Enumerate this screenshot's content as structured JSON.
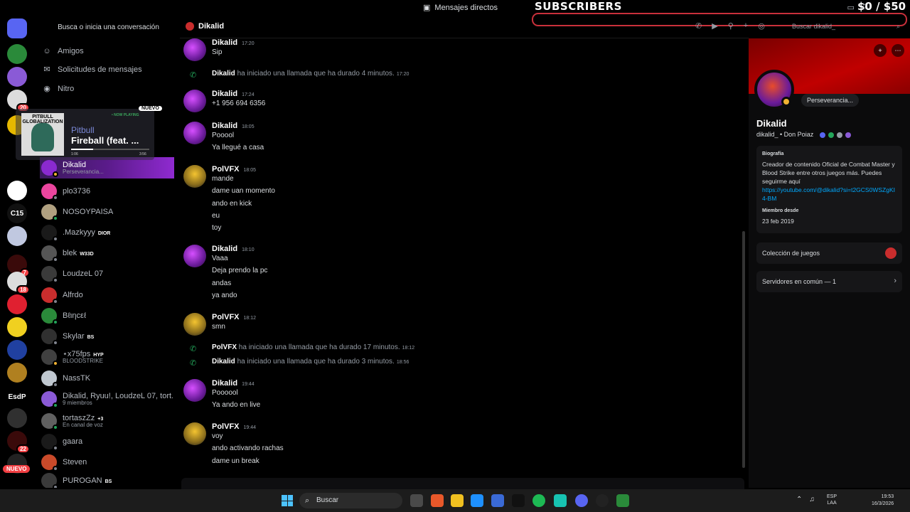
{
  "titlebar": {
    "title": "Mensajes directos"
  },
  "overlay": {
    "subscribers": "SUBSCRIBERS",
    "money": "$0 / $50"
  },
  "rail": {
    "servers": [
      {
        "name": "discord-home",
        "color": "#5865f2",
        "label": ""
      },
      {
        "name": "server-green",
        "color": "#2a8a3a",
        "label": "",
        "badge": ""
      },
      {
        "name": "server-purple",
        "color": "#8a5ad6",
        "label": ""
      },
      {
        "name": "server-voice",
        "color": "#dcdcdc",
        "label": "",
        "badge": "20"
      },
      {
        "name": "server-fortnite",
        "color": "#e6b800",
        "label": ""
      },
      {
        "name": "server-ghost",
        "color": "#ffffff",
        "label": ""
      },
      {
        "name": "server-c15",
        "color": "#111111",
        "label": "C15"
      },
      {
        "name": "server-anime",
        "color": "#c0c8e0",
        "label": ""
      },
      {
        "name": "server-red",
        "color": "#3a0a0a",
        "label": "",
        "badge": "7"
      },
      {
        "name": "server-skull",
        "color": "#dddddd",
        "label": "",
        "badge": "18"
      },
      {
        "name": "server-tiktok",
        "color": "#e02030",
        "label": ""
      },
      {
        "name": "server-yellow",
        "color": "#f0d020",
        "label": ""
      },
      {
        "name": "server-blue",
        "color": "#2040a0",
        "label": ""
      },
      {
        "name": "server-gold",
        "color": "#b08020",
        "label": ""
      },
      {
        "name": "server-esdp",
        "color": "#000000",
        "label": "EsdP"
      },
      {
        "name": "server-dark",
        "color": "#303030",
        "label": ""
      },
      {
        "name": "server-fire",
        "color": "#3a0a0a",
        "label": "",
        "badge": "22"
      },
      {
        "name": "server-eternity",
        "color": "#222222",
        "label": ""
      }
    ],
    "nuevo": "NUEVO"
  },
  "dmlist": {
    "search": "Busca o inicia una conversación",
    "nav": [
      {
        "icon": "friends-icon",
        "glyph": "☺",
        "label": "Amigos"
      },
      {
        "icon": "mail-icon",
        "glyph": "✉",
        "label": "Solicitudes de mensajes"
      },
      {
        "icon": "nitro-icon",
        "glyph": "◉",
        "label": "Nitro"
      }
    ],
    "items": [
      {
        "name": "Dikalid",
        "sub": "Perseverancia...",
        "color": "#8a2ad0",
        "status": "#f0b232",
        "active": true,
        "tag": ""
      },
      {
        "name": "plo3736",
        "sub": "",
        "color": "#eb459e",
        "status": "#80848e",
        "tag": ""
      },
      {
        "name": "NOSOYPAISA",
        "sub": "",
        "color": "#b0a080",
        "status": "#23a55a",
        "tag": ""
      },
      {
        "name": ".Mazkyyy",
        "sub": "",
        "color": "#1a1a1a",
        "status": "#80848e",
        "tag": "DIOR"
      },
      {
        "name": "blek",
        "sub": "",
        "color": "#555555",
        "status": "#80848e",
        "tag": "W33D"
      },
      {
        "name": "LoudzeL 07",
        "sub": "",
        "color": "#3a3a3a",
        "status": "#80848e",
        "tag": ""
      },
      {
        "name": "Alfrdo",
        "sub": "",
        "color": "#c92d2d",
        "status": "#80848e",
        "tag": ""
      },
      {
        "name": "Bℓιηcεℓ",
        "sub": "",
        "color": "#2a8a3a",
        "status": "#23a55a",
        "tag": ""
      },
      {
        "name": "Skylar",
        "sub": "",
        "color": "#303030",
        "status": "#80848e",
        "tag": "BS"
      },
      {
        "name": "⋆x75fps",
        "sub": "BLOODSTRIKE",
        "color": "#404040",
        "status": "#f0b232",
        "tag": "HYP"
      },
      {
        "name": "NassTK",
        "sub": "",
        "color": "#c0c8d0",
        "status": "#80848e",
        "tag": ""
      },
      {
        "name": "Dikalid, Ryuu!, LoudzeL 07, tort...",
        "sub": "9 miembros",
        "color": "#8a5ad6",
        "status": "#23a55a",
        "tag": ""
      },
      {
        "name": "tortaszZz",
        "sub": "En canal de voz",
        "color": "#606060",
        "status": "#23a55a",
        "tag": "+3"
      },
      {
        "name": "gaara",
        "sub": "",
        "color": "#1a1a1a",
        "status": "#80848e",
        "tag": ""
      },
      {
        "name": "Steven",
        "sub": "",
        "color": "#c94a2a",
        "status": "#80848e",
        "tag": ""
      },
      {
        "name": "PUROGAN",
        "sub": "",
        "color": "#3a3a3a",
        "status": "#80848e",
        "tag": "BS"
      }
    ]
  },
  "nowplaying": {
    "tag": "• NOW PLAYING",
    "album": "PITBULL GLOBALIZATION",
    "artist": "Pitbull",
    "title": "Fireball (feat. ...",
    "elapsed": "1:06",
    "duration": "3:56",
    "progress": 0.28,
    "nuevo": "NUEVO"
  },
  "chat": {
    "header": "Dikalid",
    "search": "Buscar dikalid_",
    "messages": [
      {
        "type": "msg",
        "author": "Dikalid",
        "time": "17:20",
        "avatar": "dikalid",
        "lines": [
          "Sip"
        ]
      },
      {
        "type": "sys",
        "author": "Dikalid",
        "text": " ha iniciado una llamada que ha durado 4 minutos.",
        "time": "17:20"
      },
      {
        "type": "msg",
        "author": "Dikalid",
        "time": "17:24",
        "avatar": "dikalid",
        "lines": [
          "+1 956 694 6356"
        ]
      },
      {
        "type": "msg",
        "author": "Dikalid",
        "time": "18:05",
        "avatar": "dikalid",
        "lines": [
          "Pooool",
          "Ya llegué a casa"
        ]
      },
      {
        "type": "msg",
        "author": "PolVFX",
        "time": "18:05",
        "avatar": "polvfx",
        "lines": [
          "mande",
          "dame uan momento",
          "ando en kick",
          "eu",
          "toy"
        ]
      },
      {
        "type": "msg",
        "author": "Dikalid",
        "time": "18:10",
        "avatar": "dikalid",
        "lines": [
          "Vaaa",
          "Deja prendo la pc",
          "andas",
          "ya ando"
        ]
      },
      {
        "type": "msg",
        "author": "PolVFX",
        "time": "18:12",
        "avatar": "polvfx",
        "lines": [
          "smn"
        ]
      },
      {
        "type": "sys",
        "author": "PolVFX",
        "text": " ha iniciado una llamada que ha durado 17 minutos.",
        "time": "18:12"
      },
      {
        "type": "sys",
        "author": "Dikalid",
        "text": " ha iniciado una llamada que ha durado 3 minutos.",
        "time": "18:56"
      },
      {
        "type": "msg",
        "author": "Dikalid",
        "time": "19:44",
        "avatar": "dikalid",
        "lines": [
          "Poooool",
          "Ya ando en live"
        ]
      },
      {
        "type": "msg",
        "author": "PolVFX",
        "time": "19:44",
        "avatar": "polvfx",
        "lines": [
          "voy",
          "ando activando rachas",
          "dame un break"
        ]
      }
    ]
  },
  "profile": {
    "status": "Perseverancia...",
    "name": "Dikalid",
    "handle": "dikalid_ • Don Poiaz",
    "bio_label": "Biografía",
    "bio": "Creador de contenido Oficial de Combat Master y Blood Strike entre otros juegos más. Puedes seguirme aquí",
    "bio_link": "https://youtube.com/@dikalid?si=t2GCS0WSZgKI4-BM",
    "since_label": "Miembro desde",
    "since": "23 feb 2019",
    "games": "Colección de juegos",
    "servers": "Servidores en común — 1"
  },
  "taskbar": {
    "search": "Buscar",
    "lang1": "ESP",
    "lang2": "LAA",
    "time": "19:53",
    "date": "16/3/2026"
  }
}
